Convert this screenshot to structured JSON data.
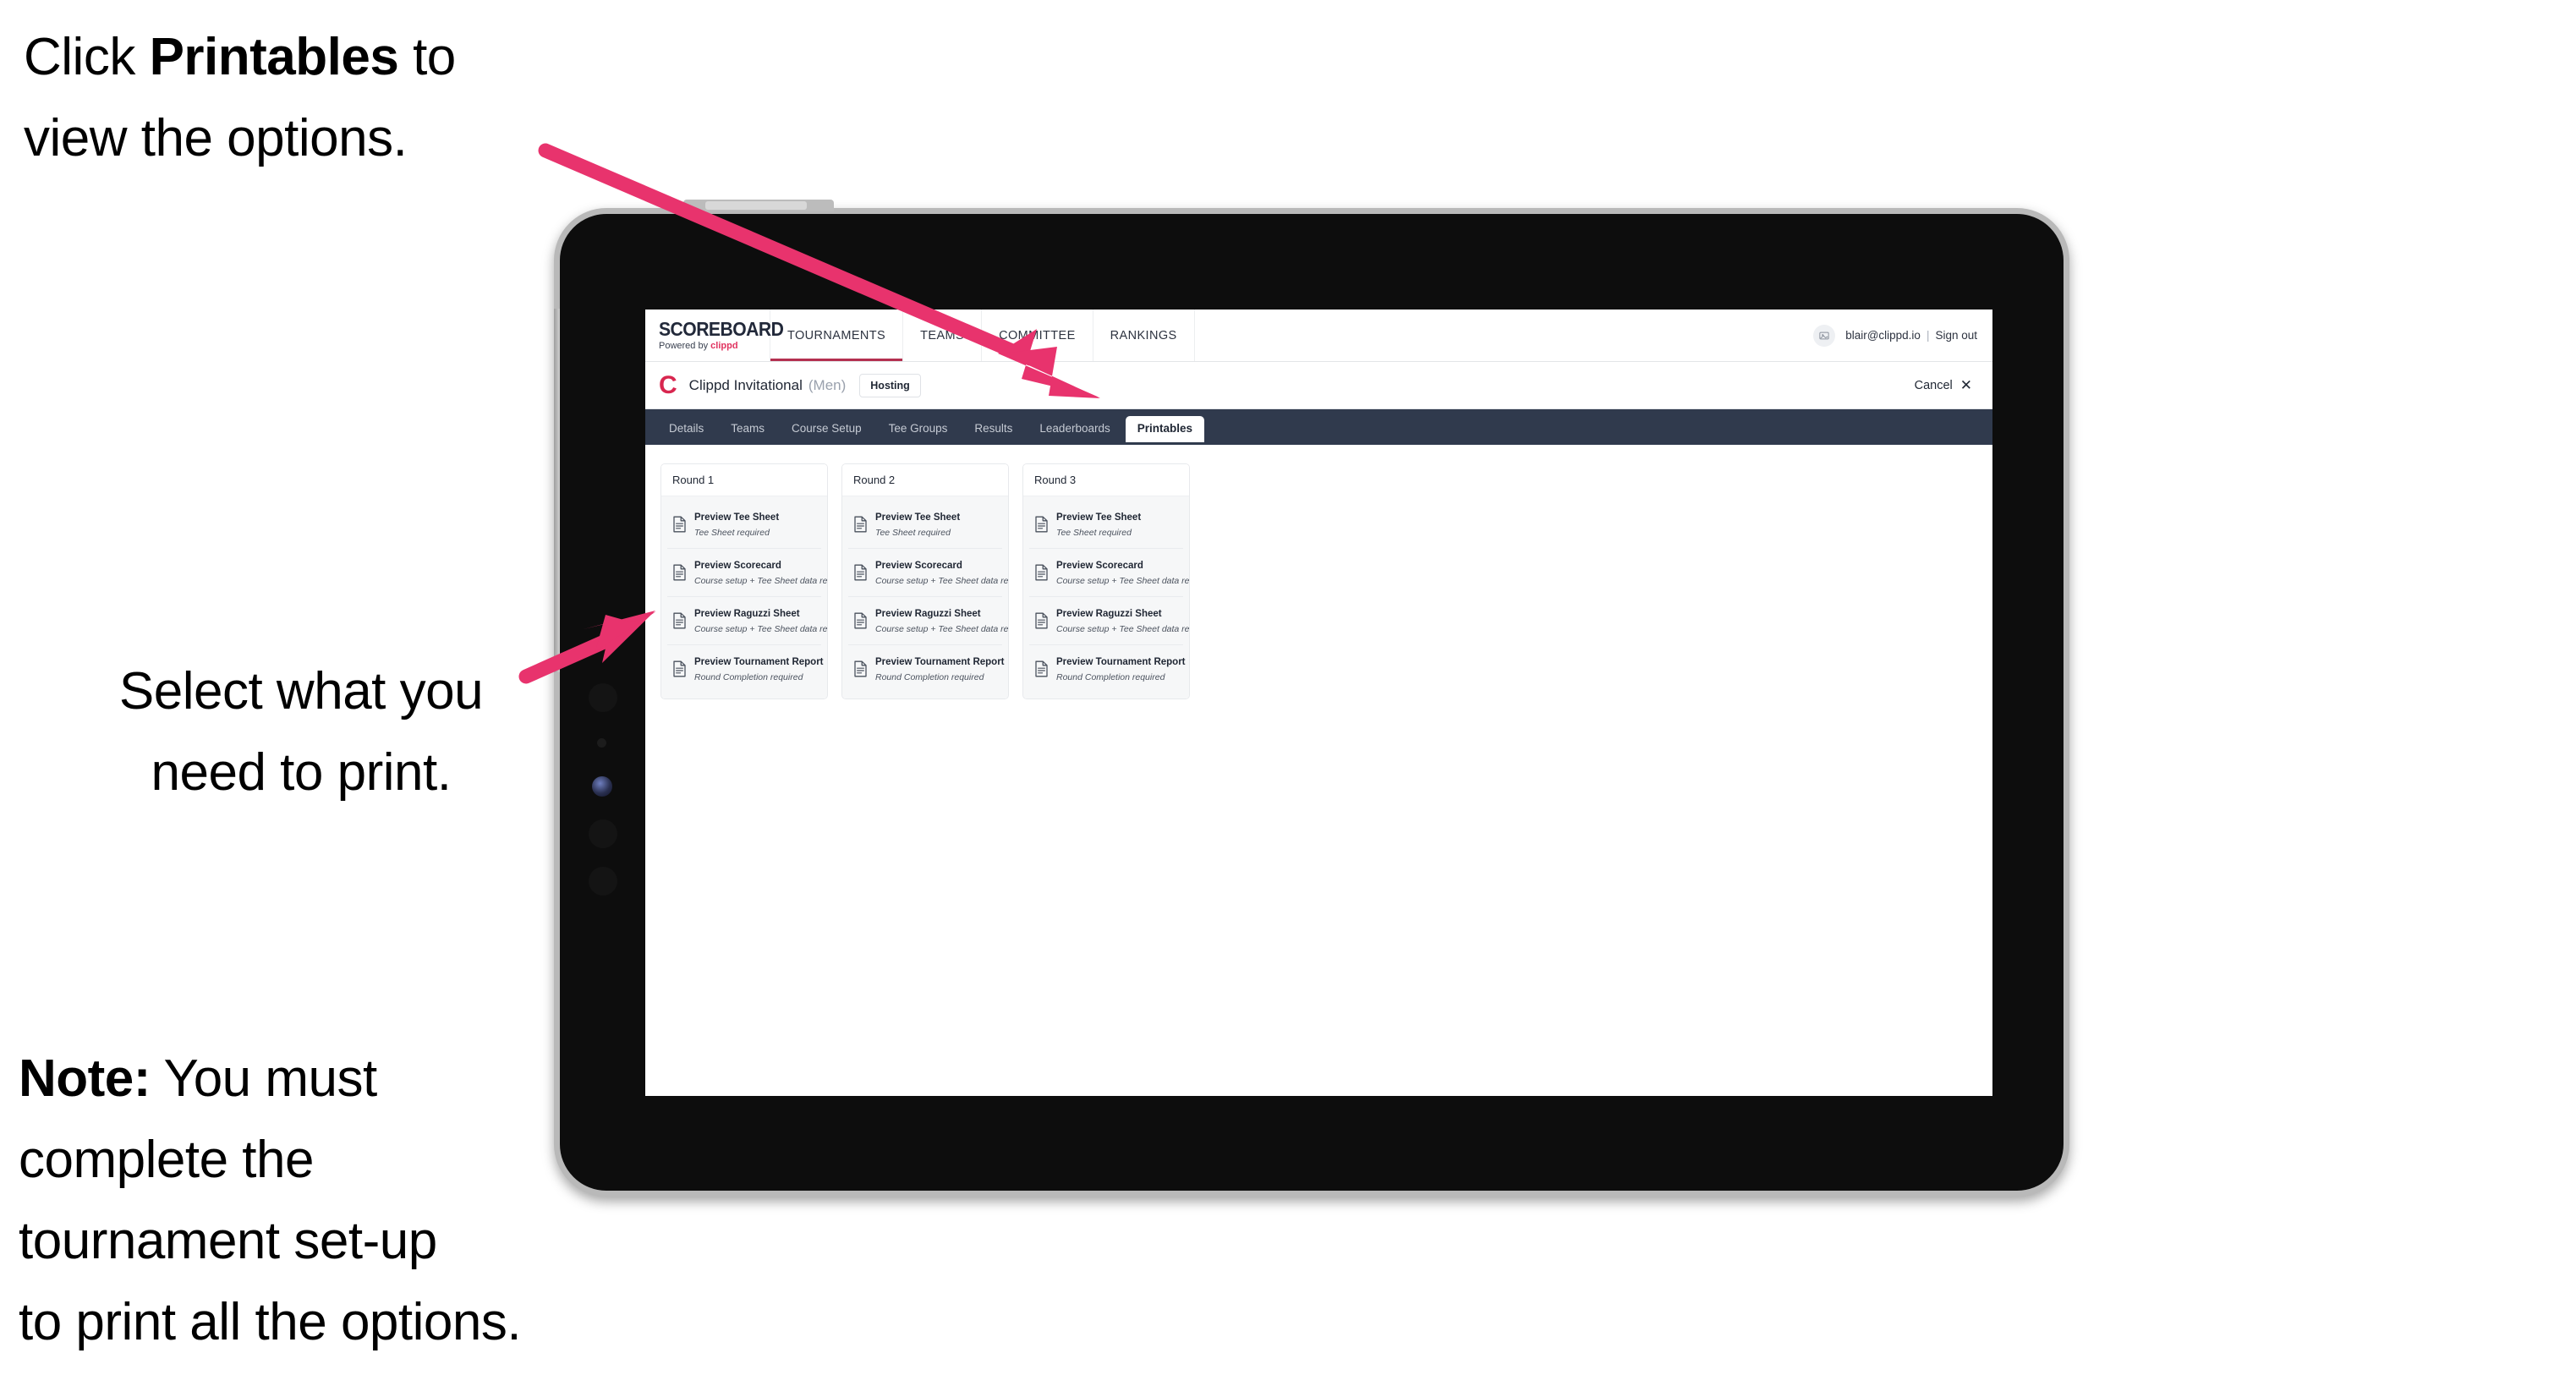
{
  "annotations": {
    "top": {
      "pre": "Click ",
      "bold": "Printables",
      "post": " to",
      "line2": "view the options."
    },
    "middle": {
      "line1": "Select what you",
      "line2": "need to print."
    },
    "note": {
      "bold": "Note:",
      "rest": " You must",
      "line2": "complete the",
      "line3": "tournament set-up",
      "line4": "to print all the options."
    }
  },
  "app": {
    "logo": {
      "word": "SCOREBOARD",
      "powered_prefix": "Powered by ",
      "brand": "clippd"
    },
    "main_nav": [
      {
        "label": "TOURNAMENTS",
        "active": true
      },
      {
        "label": "TEAMS",
        "active": false
      },
      {
        "label": "COMMITTEE",
        "active": false
      },
      {
        "label": "RANKINGS",
        "active": false
      }
    ],
    "account": {
      "avatar_glyph": "❑",
      "email": "blair@clippd.io",
      "separator": "|",
      "sign_out": "Sign out"
    },
    "tournament": {
      "mark": "C",
      "name": "Clippd Invitational",
      "gender": "(Men)",
      "badge": "Hosting",
      "cancel_label": "Cancel",
      "cancel_icon": "✕"
    },
    "section_tabs": [
      {
        "label": "Details",
        "active": false
      },
      {
        "label": "Teams",
        "active": false
      },
      {
        "label": "Course Setup",
        "active": false
      },
      {
        "label": "Tee Groups",
        "active": false
      },
      {
        "label": "Results",
        "active": false
      },
      {
        "label": "Leaderboards",
        "active": false
      },
      {
        "label": "Printables",
        "active": true
      }
    ],
    "rounds": [
      {
        "title": "Round 1",
        "items": [
          {
            "title": "Preview Tee Sheet",
            "subtitle": "Tee Sheet required"
          },
          {
            "title": "Preview Scorecard",
            "subtitle": "Course setup + Tee Sheet data required"
          },
          {
            "title": "Preview Raguzzi Sheet",
            "subtitle": "Course setup + Tee Sheet data required"
          },
          {
            "title": "Preview Tournament Report",
            "subtitle": "Round Completion required"
          }
        ]
      },
      {
        "title": "Round 2",
        "items": [
          {
            "title": "Preview Tee Sheet",
            "subtitle": "Tee Sheet required"
          },
          {
            "title": "Preview Scorecard",
            "subtitle": "Course setup + Tee Sheet data required"
          },
          {
            "title": "Preview Raguzzi Sheet",
            "subtitle": "Course setup + Tee Sheet data required"
          },
          {
            "title": "Preview Tournament Report",
            "subtitle": "Round Completion required"
          }
        ]
      },
      {
        "title": "Round 3",
        "items": [
          {
            "title": "Preview Tee Sheet",
            "subtitle": "Tee Sheet required"
          },
          {
            "title": "Preview Scorecard",
            "subtitle": "Course setup + Tee Sheet data required"
          },
          {
            "title": "Preview Raguzzi Sheet",
            "subtitle": "Course setup + Tee Sheet data required"
          },
          {
            "title": "Preview Tournament Report",
            "subtitle": "Round Completion required"
          }
        ]
      }
    ]
  },
  "colors": {
    "accent_pink": "#e8336d",
    "brand_crimson": "#d8264f",
    "navy_tabbar": "#303a4d",
    "nav_active_underline": "#b43050",
    "device_body": "#0d0d0d",
    "device_bezel": "#b9b9b9"
  }
}
